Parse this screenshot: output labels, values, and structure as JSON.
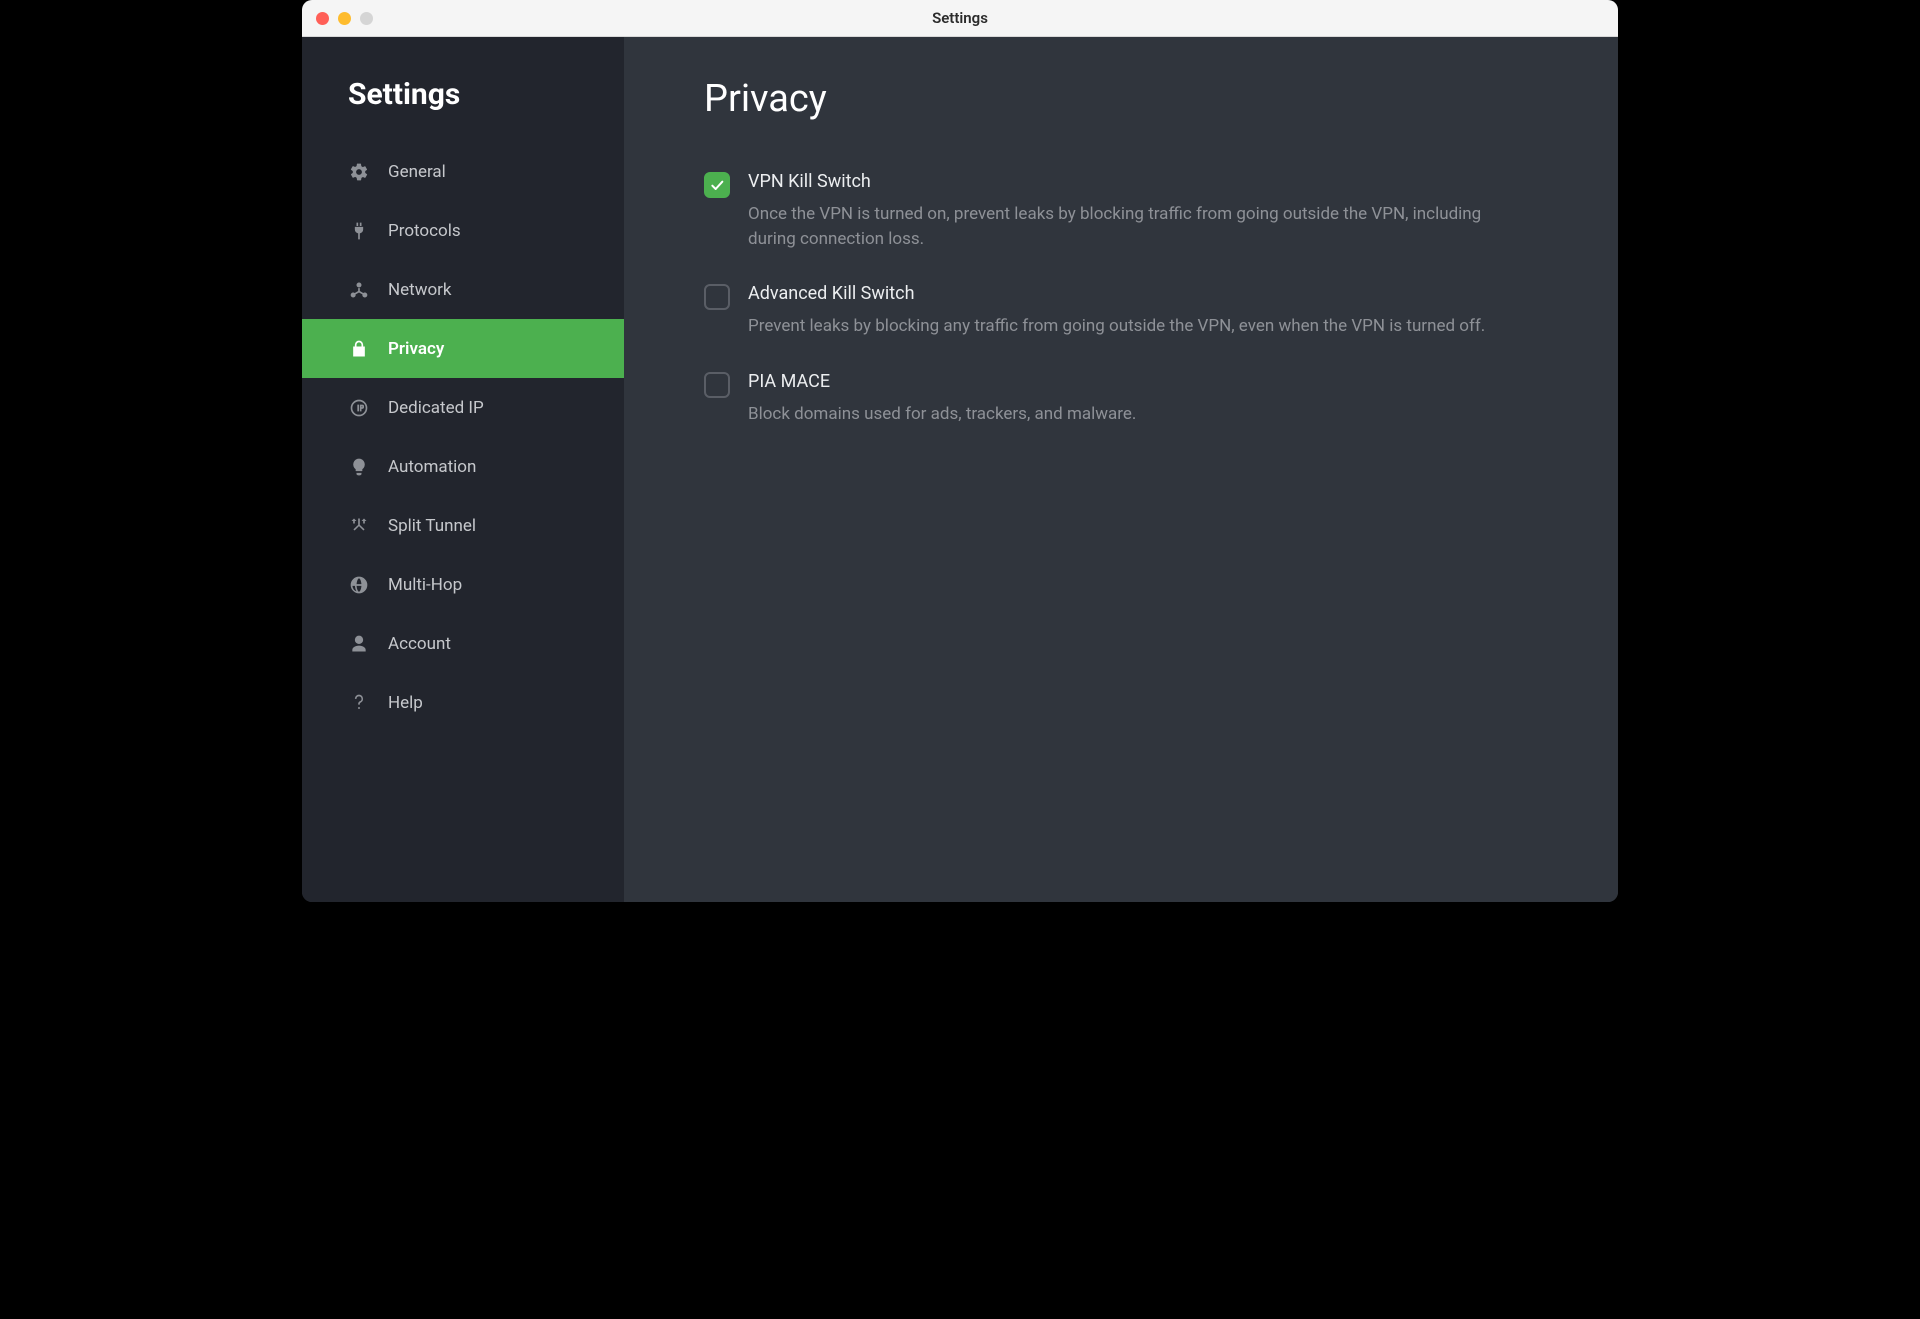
{
  "window": {
    "title": "Settings"
  },
  "sidebar": {
    "heading": "Settings",
    "items": [
      {
        "label": "General",
        "icon": "gear-icon",
        "active": false
      },
      {
        "label": "Protocols",
        "icon": "plug-icon",
        "active": false
      },
      {
        "label": "Network",
        "icon": "network-icon",
        "active": false
      },
      {
        "label": "Privacy",
        "icon": "lock-icon",
        "active": true
      },
      {
        "label": "Dedicated IP",
        "icon": "ip-icon",
        "active": false
      },
      {
        "label": "Automation",
        "icon": "lightbulb-icon",
        "active": false
      },
      {
        "label": "Split Tunnel",
        "icon": "split-icon",
        "active": false
      },
      {
        "label": "Multi-Hop",
        "icon": "globe-icon",
        "active": false
      },
      {
        "label": "Account",
        "icon": "user-icon",
        "active": false
      },
      {
        "label": "Help",
        "icon": "question-icon",
        "active": false
      }
    ]
  },
  "content": {
    "heading": "Privacy",
    "options": [
      {
        "title": "VPN Kill Switch",
        "desc": "Once the VPN is turned on, prevent leaks by blocking traffic from going outside the VPN, including during connection loss.",
        "checked": true
      },
      {
        "title": "Advanced Kill Switch",
        "desc": "Prevent leaks by blocking any traffic from going outside the VPN, even when the VPN is turned off.",
        "checked": false
      },
      {
        "title": "PIA MACE",
        "desc": "Block domains used for ads, trackers, and malware.",
        "checked": false
      }
    ]
  },
  "colors": {
    "accent": "#4cb04f",
    "sidebar_bg": "#22252d",
    "content_bg": "#30353d",
    "text_muted": "#8e9197"
  }
}
